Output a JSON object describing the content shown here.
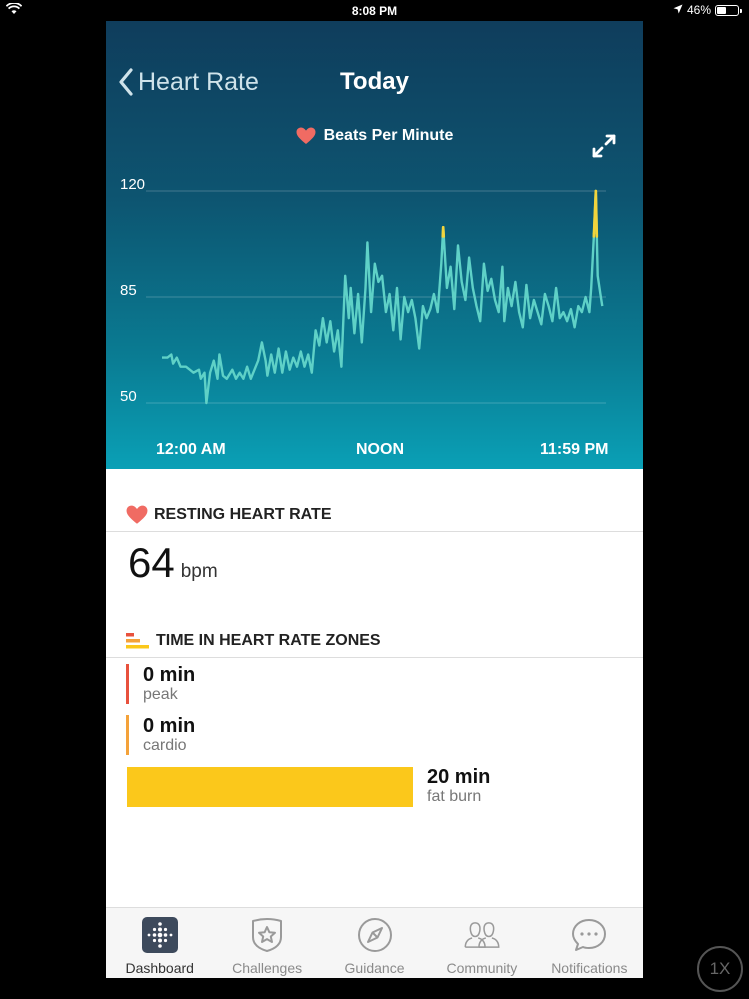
{
  "status_bar": {
    "time": "8:08 PM",
    "battery_text": "46%",
    "battery_level": 0.46
  },
  "header": {
    "back_label": "Heart Rate",
    "title": "Today",
    "legend_label": "Beats Per Minute"
  },
  "chart_data": {
    "type": "line",
    "title": "Beats Per Minute",
    "y_ticks": [
      120,
      85,
      50
    ],
    "ylim": [
      50,
      120
    ],
    "x_tick_labels": [
      "12:00 AM",
      "NOON",
      "11:59 PM"
    ],
    "x_unit": "hours since midnight",
    "xlim": [
      0,
      24
    ],
    "grid": true,
    "series": [
      {
        "name": "Beats Per Minute",
        "color": "#5fd1c7",
        "points": [
          [
            0.0,
            65
          ],
          [
            0.3,
            65
          ],
          [
            0.5,
            66
          ],
          [
            0.6,
            63
          ],
          [
            0.8,
            65
          ],
          [
            1.0,
            62
          ],
          [
            1.3,
            62
          ],
          [
            1.5,
            61
          ],
          [
            1.7,
            60
          ],
          [
            2.0,
            61
          ],
          [
            2.1,
            58
          ],
          [
            2.3,
            60
          ],
          [
            2.4,
            50
          ],
          [
            2.6,
            60
          ],
          [
            2.8,
            64
          ],
          [
            3.0,
            58
          ],
          [
            3.1,
            66
          ],
          [
            3.3,
            59
          ],
          [
            3.5,
            58
          ],
          [
            3.8,
            61
          ],
          [
            4.0,
            58
          ],
          [
            4.2,
            60
          ],
          [
            4.4,
            58
          ],
          [
            4.6,
            62
          ],
          [
            4.8,
            58
          ],
          [
            5.0,
            61
          ],
          [
            5.2,
            64
          ],
          [
            5.4,
            70
          ],
          [
            5.6,
            64
          ],
          [
            5.7,
            59
          ],
          [
            5.9,
            66
          ],
          [
            6.1,
            60
          ],
          [
            6.3,
            68
          ],
          [
            6.5,
            60
          ],
          [
            6.7,
            67
          ],
          [
            6.9,
            61
          ],
          [
            7.1,
            65
          ],
          [
            7.3,
            62
          ],
          [
            7.5,
            67
          ],
          [
            7.7,
            62
          ],
          [
            7.9,
            66
          ],
          [
            8.1,
            60
          ],
          [
            8.3,
            74
          ],
          [
            8.5,
            69
          ],
          [
            8.7,
            78
          ],
          [
            8.9,
            70
          ],
          [
            9.1,
            77
          ],
          [
            9.3,
            67
          ],
          [
            9.5,
            74
          ],
          [
            9.7,
            62
          ],
          [
            9.9,
            92
          ],
          [
            10.1,
            78
          ],
          [
            10.2,
            88
          ],
          [
            10.4,
            73
          ],
          [
            10.6,
            86
          ],
          [
            10.8,
            70
          ],
          [
            11.0,
            88
          ],
          [
            11.1,
            103
          ],
          [
            11.3,
            80
          ],
          [
            11.5,
            96
          ],
          [
            11.7,
            90
          ],
          [
            11.9,
            92
          ],
          [
            12.1,
            80
          ],
          [
            12.3,
            86
          ],
          [
            12.5,
            74
          ],
          [
            12.7,
            88
          ],
          [
            12.9,
            71
          ],
          [
            13.1,
            85
          ],
          [
            13.3,
            80
          ],
          [
            13.5,
            84
          ],
          [
            13.7,
            78
          ],
          [
            13.9,
            68
          ],
          [
            14.1,
            82
          ],
          [
            14.3,
            78
          ],
          [
            14.5,
            81
          ],
          [
            14.7,
            86
          ],
          [
            14.9,
            80
          ],
          [
            15.1,
            96
          ],
          [
            15.2,
            108
          ],
          [
            15.4,
            88
          ],
          [
            15.6,
            95
          ],
          [
            15.8,
            81
          ],
          [
            16.0,
            102
          ],
          [
            16.2,
            90
          ],
          [
            16.4,
            84
          ],
          [
            16.6,
            98
          ],
          [
            16.8,
            88
          ],
          [
            17.0,
            82
          ],
          [
            17.2,
            77
          ],
          [
            17.4,
            96
          ],
          [
            17.6,
            87
          ],
          [
            17.8,
            91
          ],
          [
            18.0,
            84
          ],
          [
            18.2,
            80
          ],
          [
            18.4,
            95
          ],
          [
            18.5,
            77
          ],
          [
            18.7,
            88
          ],
          [
            18.9,
            82
          ],
          [
            19.1,
            90
          ],
          [
            19.3,
            80
          ],
          [
            19.5,
            75
          ],
          [
            19.7,
            89
          ],
          [
            19.9,
            78
          ],
          [
            20.1,
            84
          ],
          [
            20.3,
            80
          ],
          [
            20.5,
            76
          ],
          [
            20.7,
            86
          ],
          [
            20.9,
            82
          ],
          [
            21.1,
            77
          ],
          [
            21.3,
            88
          ],
          [
            21.5,
            78
          ],
          [
            21.7,
            80
          ],
          [
            21.9,
            77
          ],
          [
            22.1,
            81
          ],
          [
            22.3,
            75
          ],
          [
            22.5,
            82
          ],
          [
            22.7,
            80
          ],
          [
            22.9,
            85
          ],
          [
            23.1,
            80
          ],
          [
            23.2,
            88
          ],
          [
            23.35,
            106
          ],
          [
            23.45,
            120
          ],
          [
            23.55,
            92
          ],
          [
            23.7,
            86
          ],
          [
            23.8,
            82
          ]
        ]
      }
    ],
    "highlight_threshold_bpm": 105,
    "highlight_color": "#f2d43c"
  },
  "resting": {
    "section_title": "RESTING HEART RATE",
    "value": "64",
    "unit": "bpm"
  },
  "zones": {
    "section_title": "TIME IN HEART RATE ZONES",
    "items": [
      {
        "value": "0 min",
        "label": "peak",
        "color": "#e8513d",
        "fraction": 0
      },
      {
        "value": "0 min",
        "label": "cardio",
        "color": "#f4a23a",
        "fraction": 0
      },
      {
        "value": "20 min",
        "label": "fat burn",
        "color": "#fbc81b",
        "fraction": 1
      }
    ]
  },
  "tabs": [
    {
      "label": "Dashboard",
      "icon": "dashboard-icon",
      "active": true
    },
    {
      "label": "Challenges",
      "icon": "star-badge-icon",
      "active": false
    },
    {
      "label": "Guidance",
      "icon": "compass-icon",
      "active": false
    },
    {
      "label": "Community",
      "icon": "people-icon",
      "active": false
    },
    {
      "label": "Notifications",
      "icon": "chat-bubble-icon",
      "active": false
    }
  ],
  "zoom_badge": "1X",
  "colors": {
    "accent_heart": "#f06b63",
    "fat_burn": "#fbc81b",
    "peak": "#e8513d",
    "cardio": "#f4a23a"
  }
}
